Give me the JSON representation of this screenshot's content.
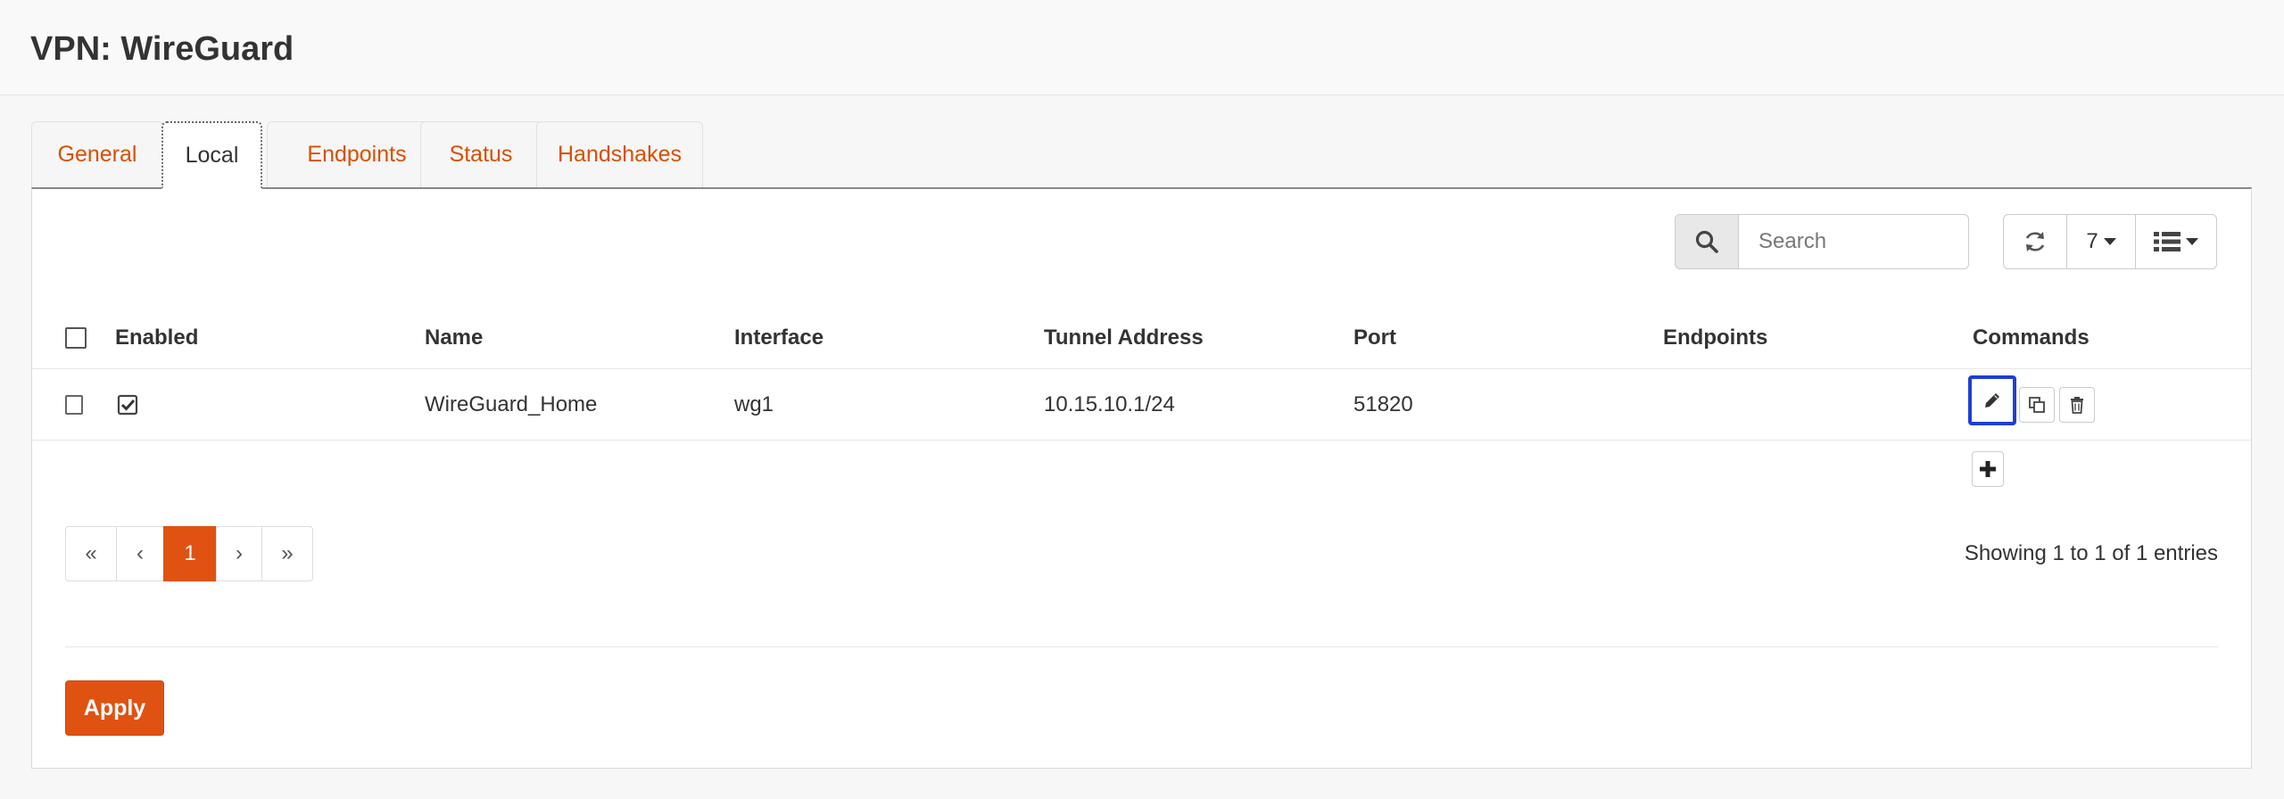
{
  "page": {
    "title": "VPN: WireGuard"
  },
  "tabs": [
    {
      "label": "General"
    },
    {
      "label": "Local"
    },
    {
      "label": "Endpoints"
    },
    {
      "label": "Status"
    },
    {
      "label": "Handshakes"
    }
  ],
  "active_tab": "Local",
  "search": {
    "placeholder": "Search",
    "value": "",
    "icon": "search-icon"
  },
  "toolbar": {
    "refresh_icon": "refresh-icon",
    "page_size": "7",
    "columns_icon": "list-icon"
  },
  "table": {
    "columns": [
      "Enabled",
      "Name",
      "Interface",
      "Tunnel Address",
      "Port",
      "Endpoints",
      "Commands"
    ],
    "rows": [
      {
        "selected": false,
        "enabled": true,
        "name": "WireGuard_Home",
        "interface": "wg1",
        "tunnel_address": "10.15.10.1/24",
        "port": "51820",
        "endpoints": ""
      }
    ]
  },
  "commands": {
    "edit_icon": "pencil-icon",
    "copy_icon": "copy-icon",
    "delete_icon": "trash-icon",
    "add_label": "+"
  },
  "pagination": {
    "first": "«",
    "prev": "‹",
    "current": "1",
    "next": "›",
    "last": "»"
  },
  "entries_text": "Showing 1 to 1 of 1 entries",
  "apply_label": "Apply",
  "colors": {
    "accent": "#e05212",
    "tab_text": "#d94f00",
    "highlight": "#1f3fd6"
  }
}
